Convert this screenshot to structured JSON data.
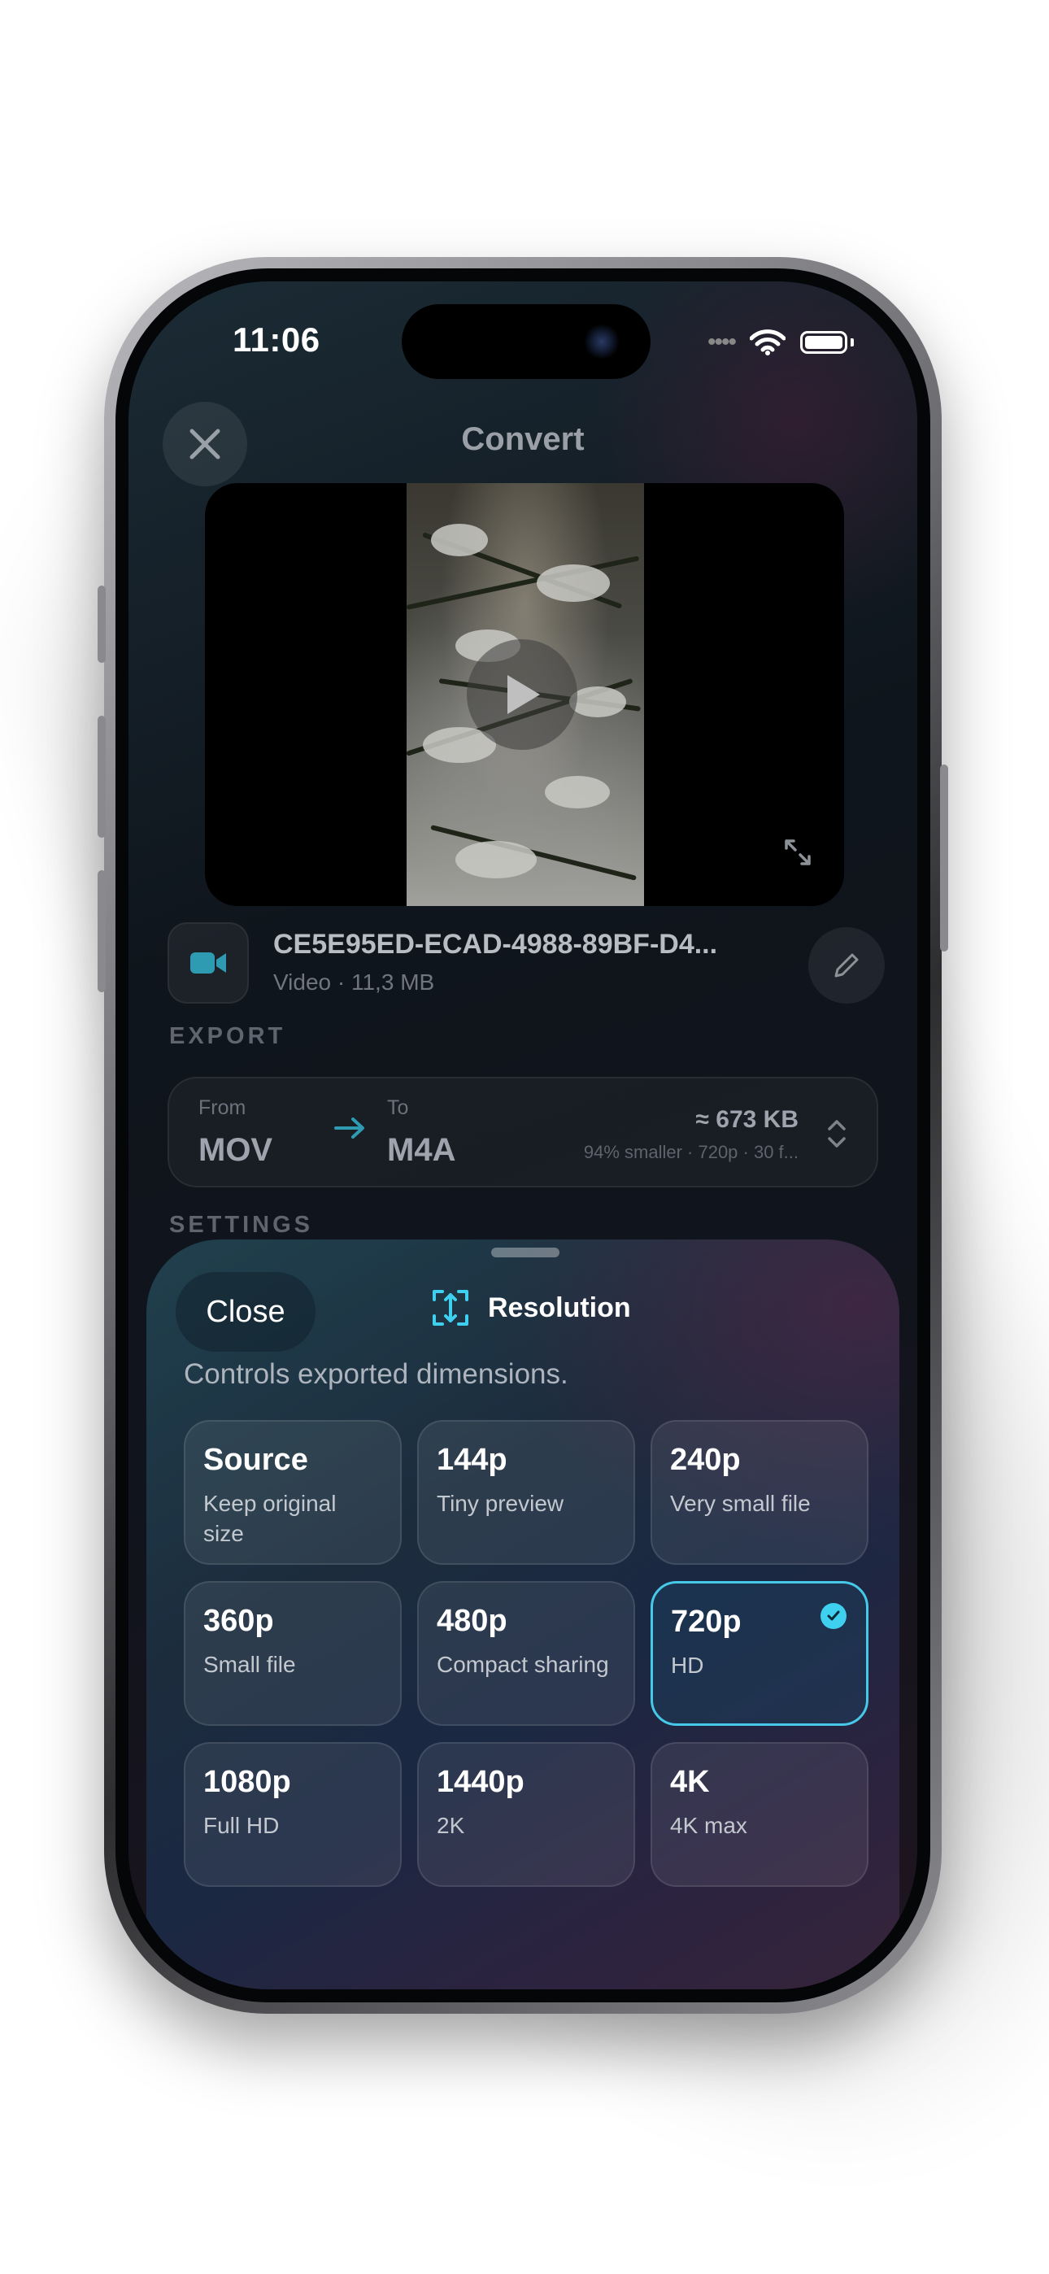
{
  "status_bar": {
    "time": "11:06"
  },
  "header": {
    "title": "Convert"
  },
  "file": {
    "name": "CE5E95ED-ECAD-4988-89BF-D4...",
    "meta": "Video · 11,3 MB"
  },
  "sections": {
    "export": "EXPORT",
    "settings": "SETTINGS"
  },
  "export": {
    "from_label": "From",
    "from_value": "MOV",
    "to_label": "To",
    "to_value": "M4A",
    "size": "≈ 673 KB",
    "detail": "94% smaller · 720p · 30 f..."
  },
  "sheet": {
    "close_label": "Close",
    "title": "Resolution",
    "description": "Controls exported dimensions.",
    "selected": "720p",
    "options": [
      {
        "title": "Source",
        "subtitle": "Keep original size"
      },
      {
        "title": "144p",
        "subtitle": "Tiny preview"
      },
      {
        "title": "240p",
        "subtitle": "Very small file"
      },
      {
        "title": "360p",
        "subtitle": "Small file"
      },
      {
        "title": "480p",
        "subtitle": "Compact sharing"
      },
      {
        "title": "720p",
        "subtitle": "HD"
      },
      {
        "title": "1080p",
        "subtitle": "Full HD"
      },
      {
        "title": "1440p",
        "subtitle": "2K"
      },
      {
        "title": "4K",
        "subtitle": "4K max"
      }
    ]
  },
  "colors": {
    "accent": "#3fd0ef",
    "arrow": "#2e9bb3"
  },
  "icons": [
    "close-icon",
    "play-icon",
    "expand-icon",
    "video-camera-icon",
    "pencil-icon",
    "arrow-right-icon",
    "chevron-up-down-icon",
    "resize-icon",
    "checkmark-icon",
    "wifi-icon",
    "battery-icon"
  ]
}
